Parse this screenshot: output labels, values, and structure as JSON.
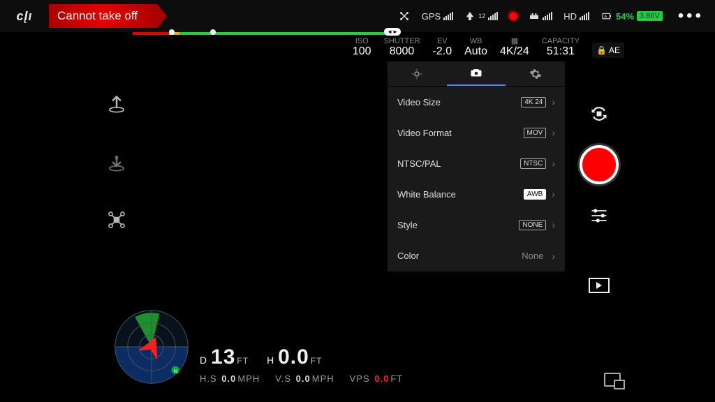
{
  "header": {
    "logo": "cĮı",
    "status": "Cannot take off",
    "gps_label": "GPS",
    "rc_count": "12",
    "hd_label": "HD",
    "battery_pct": "54%",
    "battery_voltage": "3.86V",
    "more": "•••"
  },
  "camera_strip": {
    "iso_label": "ISO",
    "iso": "100",
    "shutter_label": "SHUTTER",
    "shutter": "8000",
    "ev_label": "EV",
    "ev": "-2.0",
    "wb_label": "WB",
    "wb": "Auto",
    "res_label": "",
    "res": "4K/24",
    "cap_label": "CAPACITY",
    "cap": "51:31",
    "ae_lock": "AE"
  },
  "settings": {
    "rows": [
      {
        "label": "Video Size",
        "value": "4K 24"
      },
      {
        "label": "Video Format",
        "value": "MOV"
      },
      {
        "label": "NTSC/PAL",
        "value": "NTSC"
      },
      {
        "label": "White Balance",
        "value": "AWB"
      },
      {
        "label": "Style",
        "value": "NONE"
      },
      {
        "label": "Color",
        "value": "None"
      }
    ]
  },
  "telemetry": {
    "d_label": "D",
    "d_value": "13",
    "d_unit": "FT",
    "h_label": "H",
    "h_value": "0.0",
    "h_unit": "FT",
    "hs_label": "H.S",
    "hs_value": "0.0",
    "hs_unit": "MPH",
    "vs_label": "V.S",
    "vs_value": "0.0",
    "vs_unit": "MPH",
    "vps_label": "VPS",
    "vps_value": "0.0",
    "vps_unit": "FT"
  }
}
